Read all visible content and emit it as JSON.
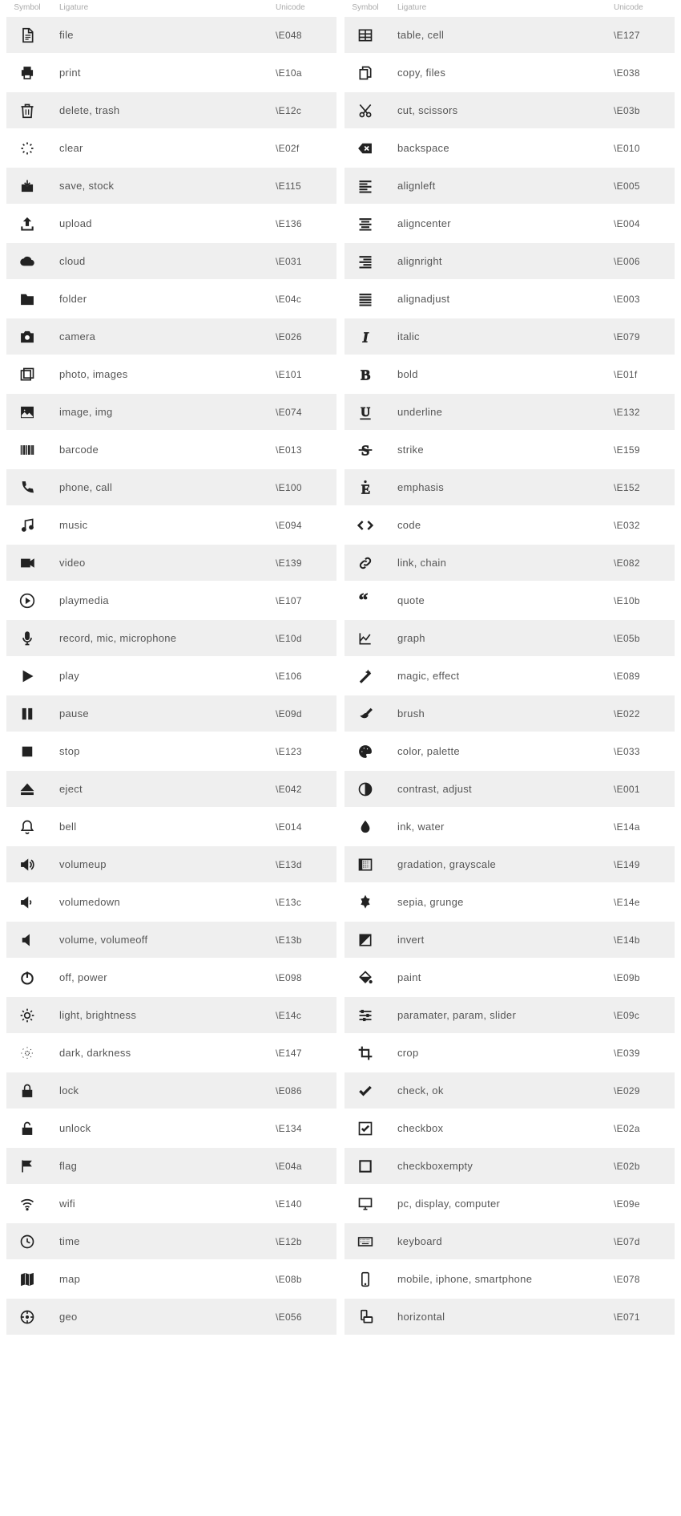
{
  "headers": {
    "symbol": "Symbol",
    "ligature": "Ligature",
    "unicode": "Unicode"
  },
  "left": [
    {
      "icon": "file",
      "ligature": "file",
      "unicode": "\\E048"
    },
    {
      "icon": "print",
      "ligature": "print",
      "unicode": "\\E10a"
    },
    {
      "icon": "trash",
      "ligature": "delete, trash",
      "unicode": "\\E12c"
    },
    {
      "icon": "clear",
      "ligature": "clear",
      "unicode": "\\E02f"
    },
    {
      "icon": "save",
      "ligature": "save, stock",
      "unicode": "\\E115"
    },
    {
      "icon": "upload",
      "ligature": "upload",
      "unicode": "\\E136"
    },
    {
      "icon": "cloud",
      "ligature": "cloud",
      "unicode": "\\E031"
    },
    {
      "icon": "folder",
      "ligature": "folder",
      "unicode": "\\E04c"
    },
    {
      "icon": "camera",
      "ligature": "camera",
      "unicode": "\\E026"
    },
    {
      "icon": "photo",
      "ligature": "photo, images",
      "unicode": "\\E101"
    },
    {
      "icon": "image",
      "ligature": "image, img",
      "unicode": "\\E074"
    },
    {
      "icon": "barcode",
      "ligature": "barcode",
      "unicode": "\\E013"
    },
    {
      "icon": "phone",
      "ligature": "phone, call",
      "unicode": "\\E100"
    },
    {
      "icon": "music",
      "ligature": "music",
      "unicode": "\\E094"
    },
    {
      "icon": "video",
      "ligature": "video",
      "unicode": "\\E139"
    },
    {
      "icon": "playmedia",
      "ligature": "playmedia",
      "unicode": "\\E107"
    },
    {
      "icon": "mic",
      "ligature": "record, mic, microphone",
      "unicode": "\\E10d"
    },
    {
      "icon": "play",
      "ligature": "play",
      "unicode": "\\E106"
    },
    {
      "icon": "pause",
      "ligature": "pause",
      "unicode": "\\E09d"
    },
    {
      "icon": "stop",
      "ligature": "stop",
      "unicode": "\\E123"
    },
    {
      "icon": "eject",
      "ligature": "eject",
      "unicode": "\\E042"
    },
    {
      "icon": "bell",
      "ligature": "bell",
      "unicode": "\\E014"
    },
    {
      "icon": "volumeup",
      "ligature": "volumeup",
      "unicode": "\\E13d"
    },
    {
      "icon": "volumedown",
      "ligature": "volumedown",
      "unicode": "\\E13c"
    },
    {
      "icon": "volumeoff",
      "ligature": "volume, volumeoff",
      "unicode": "\\E13b"
    },
    {
      "icon": "power",
      "ligature": "off, power",
      "unicode": "\\E098"
    },
    {
      "icon": "brightness",
      "ligature": "light, brightness",
      "unicode": "\\E14c"
    },
    {
      "icon": "dark",
      "ligature": "dark, darkness",
      "unicode": "\\E147"
    },
    {
      "icon": "lock",
      "ligature": "lock",
      "unicode": "\\E086"
    },
    {
      "icon": "unlock",
      "ligature": "unlock",
      "unicode": "\\E134"
    },
    {
      "icon": "flag",
      "ligature": "flag",
      "unicode": "\\E04a"
    },
    {
      "icon": "wifi",
      "ligature": "wifi",
      "unicode": "\\E140"
    },
    {
      "icon": "time",
      "ligature": "time",
      "unicode": "\\E12b"
    },
    {
      "icon": "map",
      "ligature": "map",
      "unicode": "\\E08b"
    },
    {
      "icon": "geo",
      "ligature": "geo",
      "unicode": "\\E056"
    }
  ],
  "right": [
    {
      "icon": "table",
      "ligature": "table, cell",
      "unicode": "\\E127"
    },
    {
      "icon": "copy",
      "ligature": "copy, files",
      "unicode": "\\E038"
    },
    {
      "icon": "cut",
      "ligature": "cut, scissors",
      "unicode": "\\E03b"
    },
    {
      "icon": "backspace",
      "ligature": "backspace",
      "unicode": "\\E010"
    },
    {
      "icon": "alignleft",
      "ligature": "alignleft",
      "unicode": "\\E005"
    },
    {
      "icon": "aligncenter",
      "ligature": "aligncenter",
      "unicode": "\\E004"
    },
    {
      "icon": "alignright",
      "ligature": "alignright",
      "unicode": "\\E006"
    },
    {
      "icon": "alignjustify",
      "ligature": "alignadjust",
      "unicode": "\\E003"
    },
    {
      "icon": "italic",
      "ligature": "italic",
      "unicode": "\\E079"
    },
    {
      "icon": "bold",
      "ligature": "bold",
      "unicode": "\\E01f"
    },
    {
      "icon": "underline",
      "ligature": "underline",
      "unicode": "\\E132"
    },
    {
      "icon": "strike",
      "ligature": "strike",
      "unicode": "\\E159"
    },
    {
      "icon": "emphasis",
      "ligature": "emphasis",
      "unicode": "\\E152"
    },
    {
      "icon": "code",
      "ligature": "code",
      "unicode": "\\E032"
    },
    {
      "icon": "link",
      "ligature": "link, chain",
      "unicode": "\\E082"
    },
    {
      "icon": "quote",
      "ligature": "quote",
      "unicode": "\\E10b"
    },
    {
      "icon": "graph",
      "ligature": "graph",
      "unicode": "\\E05b"
    },
    {
      "icon": "magic",
      "ligature": "magic, effect",
      "unicode": "\\E089"
    },
    {
      "icon": "brush",
      "ligature": "brush",
      "unicode": "\\E022"
    },
    {
      "icon": "palette",
      "ligature": "color, palette",
      "unicode": "\\E033"
    },
    {
      "icon": "contrast",
      "ligature": "contrast, adjust",
      "unicode": "\\E001"
    },
    {
      "icon": "ink",
      "ligature": "ink, water",
      "unicode": "\\E14a"
    },
    {
      "icon": "gradation",
      "ligature": "gradation, grayscale",
      "unicode": "\\E149"
    },
    {
      "icon": "sepia",
      "ligature": "sepia, grunge",
      "unicode": "\\E14e"
    },
    {
      "icon": "invert",
      "ligature": "invert",
      "unicode": "\\E14b"
    },
    {
      "icon": "paint",
      "ligature": "paint",
      "unicode": "\\E09b"
    },
    {
      "icon": "slider",
      "ligature": "paramater, param, slider",
      "unicode": "\\E09c"
    },
    {
      "icon": "crop",
      "ligature": "crop",
      "unicode": "\\E039"
    },
    {
      "icon": "check",
      "ligature": "check, ok",
      "unicode": "\\E029"
    },
    {
      "icon": "checkbox",
      "ligature": "checkbox",
      "unicode": "\\E02a"
    },
    {
      "icon": "checkboxempty",
      "ligature": "checkboxempty",
      "unicode": "\\E02b"
    },
    {
      "icon": "pc",
      "ligature": "pc, display, computer",
      "unicode": "\\E09e"
    },
    {
      "icon": "keyboard",
      "ligature": "keyboard",
      "unicode": "\\E07d"
    },
    {
      "icon": "mobile",
      "ligature": "mobile, iphone, smartphone",
      "unicode": "\\E078"
    },
    {
      "icon": "horizontal",
      "ligature": "horizontal",
      "unicode": "\\E071"
    }
  ]
}
